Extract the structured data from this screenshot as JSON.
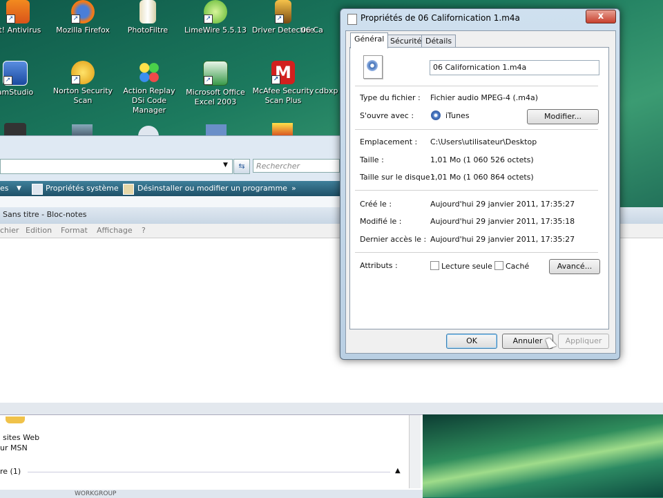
{
  "desktop": {
    "icons": [
      {
        "label": "st! Antivirus"
      },
      {
        "label": "Mozilla Firefox"
      },
      {
        "label": "PhotoFiltre"
      },
      {
        "label": "LimeWire 5.5.13"
      },
      {
        "label": "Driver Detective"
      },
      {
        "label": "06 Ca"
      },
      {
        "label": "amStudio"
      },
      {
        "label": "Norton Security Scan"
      },
      {
        "label": "Action Replay DSi Code Manager"
      },
      {
        "label": "Microsoft Office Excel 2003"
      },
      {
        "label": "McAfee Security Scan Plus"
      },
      {
        "label": "cdbxp"
      }
    ]
  },
  "explorer": {
    "search_placeholder": "Rechercher",
    "cmd": [
      "es",
      "Propriétés système",
      "Désinstaller ou modifier un programme",
      "»"
    ],
    "bottom_items": [
      "sites Web",
      "ur MSN",
      "re (1)",
      "WORKGROUP"
    ]
  },
  "notepad": {
    "title": "Sans titre - Bloc-notes",
    "menu": [
      "chier",
      "Edition",
      "Format",
      "Affichage",
      "?"
    ]
  },
  "dialog": {
    "title": "Propriétés de 06 Californication 1.m4a",
    "close": "x",
    "tabs": [
      "Général",
      "Sécurité",
      "Détails"
    ],
    "filename": "06 Californication 1.m4a",
    "rows": [
      {
        "label": "Type du fichier :",
        "value": "Fichier audio MPEG-4 (.m4a)"
      },
      {
        "label": "S'ouvre avec :",
        "value": "iTunes"
      },
      {
        "label": "Emplacement :",
        "value": "C:\\Users\\utilisateur\\Desktop"
      },
      {
        "label": "Taille :",
        "value": "1,01 Mo (1 060 526 octets)"
      },
      {
        "label": "Taille sur le disque :",
        "value": "1,01 Mo (1 060 864 octets)"
      },
      {
        "label": "Créé le :",
        "value": "Aujourd'hui 29 janvier 2011, 17:35:27"
      },
      {
        "label": "Modifié le :",
        "value": "Aujourd'hui 29 janvier 2011, 17:35:18"
      },
      {
        "label": "Dernier accès le :",
        "value": "Aujourd'hui 29 janvier 2011, 17:35:27"
      }
    ],
    "attributes_label": "Attributs :",
    "readonly_label": "Lecture seule",
    "hidden_label": "Caché",
    "buttons": {
      "modify": "Modifier...",
      "advanced": "Avancé...",
      "ok": "OK",
      "cancel": "Annuler",
      "apply": "Appliquer"
    }
  }
}
